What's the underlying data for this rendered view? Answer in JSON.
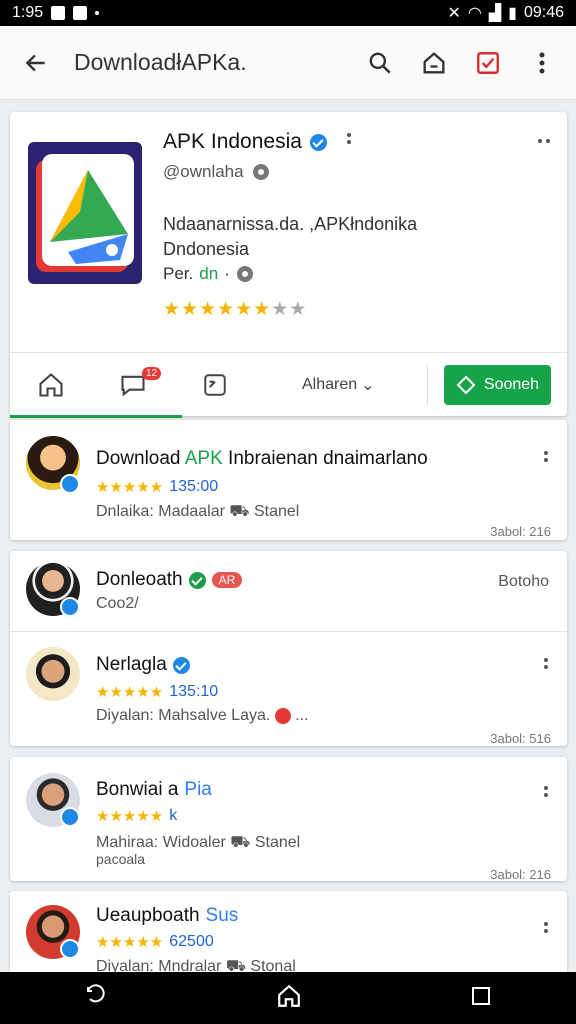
{
  "status": {
    "time": "1:95",
    "clock": "09:46"
  },
  "appbar": {
    "title": "DownloadłAPKa."
  },
  "header": {
    "name": "APK Indonesia",
    "handle": "@ownlaha",
    "desc_line1": "Ndaanarnissa.da. ,APKłndonika",
    "desc_line2": "Dndonesia",
    "sub_prefix": "Per.",
    "sub_green": "dn",
    "sub_suffix": "·",
    "stars": "★★★★★★★★",
    "rating_fraction": 0.75
  },
  "tabs": {
    "badge": "12",
    "more_label": "Alharen",
    "search_label": "Sooneh"
  },
  "items": [
    {
      "name_pre": "Download ",
      "name_green": "APK",
      "name_post": " Inbraienan dnaimarlano",
      "stars": "★★★★★",
      "number": "135:00",
      "meta": "Dnlaika: Madaalar ⛟ Stanel",
      "foot": "3abol: 216"
    },
    {
      "name_pre": "Donleoath",
      "tag": "AR",
      "sub": "Coo2/",
      "right_label": "Botoho"
    },
    {
      "name_pre": "Nerlagla",
      "stars": "★★★★★",
      "number": "135:10",
      "meta": "Diyalan: Mahsalve Laya.",
      "meta_tail": "...",
      "foot": "3abol: 516"
    },
    {
      "name_pre": "Bonwiai a ",
      "name_tag": "Pia",
      "stars": "★★★★★",
      "number": "k",
      "meta": "Mahiraa: Widoaler ⛟ Stanel",
      "meta2": "pacoala",
      "foot": "3abol: 216"
    },
    {
      "name_pre": "Ueaupboath ",
      "name_tag": "Sus",
      "stars": "★★★★★",
      "number": "62500",
      "meta": "Diyalan: Mndralar ⛟ Stonal"
    }
  ],
  "colors": {
    "accent_green": "#17a34a",
    "link_blue": "#1e63d6",
    "star_gold": "#f4b400"
  }
}
